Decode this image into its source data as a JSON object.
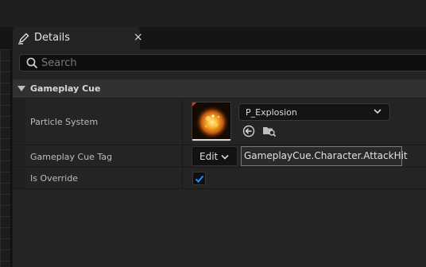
{
  "tab": {
    "title": "Details",
    "icon": "pencil-icon",
    "close_glyph": "×"
  },
  "search": {
    "placeholder": "Search",
    "value": "",
    "icon": "search-icon"
  },
  "category": {
    "label": "Gameplay Cue",
    "expanded": true
  },
  "properties": {
    "particle_system": {
      "label": "Particle System",
      "asset_name": "P_Explosion",
      "thumbnail": "explosion-particle-thumbnail",
      "actions": [
        "use-selected-asset-icon",
        "browse-to-asset-icon"
      ]
    },
    "gameplay_cue_tag": {
      "label": "Gameplay Cue Tag",
      "edit_label": "Edit",
      "value": "GameplayCue.Character.AttackHit"
    },
    "is_override": {
      "label": "Is Override",
      "checked": true
    }
  },
  "colors": {
    "panel_bg": "#242424",
    "category_bg": "#313131",
    "checkbox_check": "#1e8fff",
    "accent_particle": "#f0a030"
  }
}
